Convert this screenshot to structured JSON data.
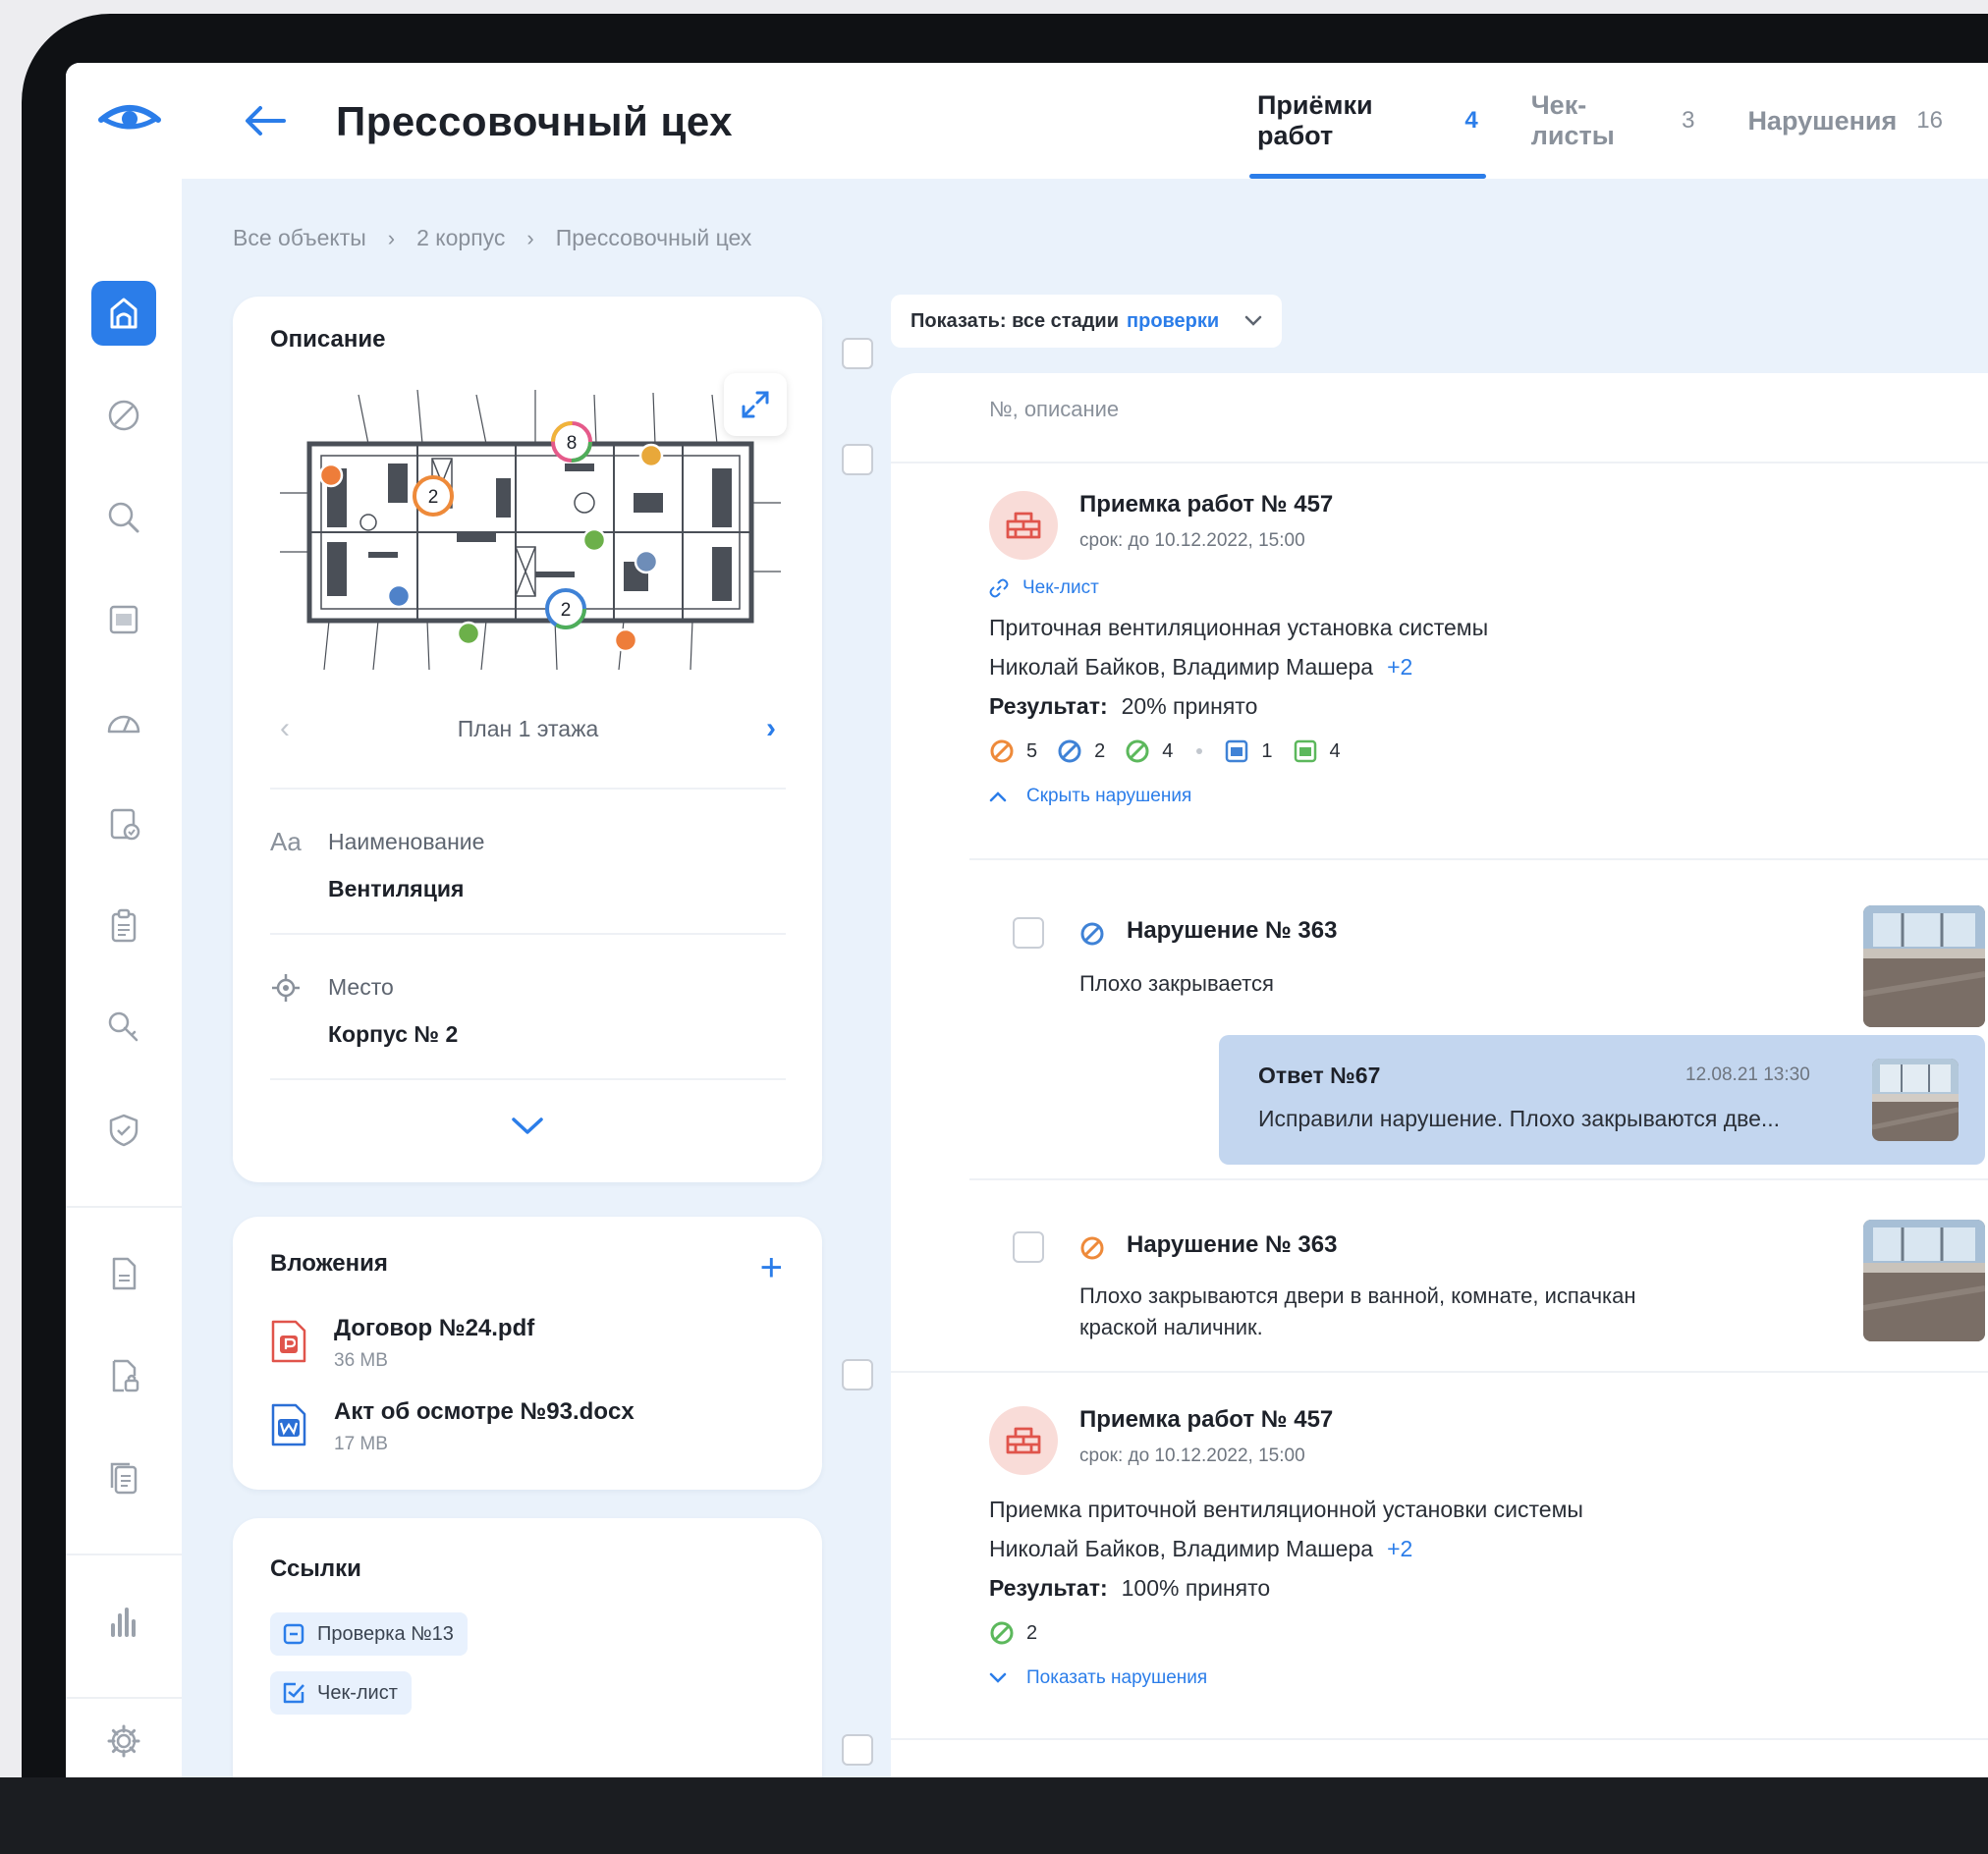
{
  "header": {
    "title": "Прессовочный цех",
    "tabs": [
      {
        "label": "Приёмки работ",
        "count": "4",
        "active": true
      },
      {
        "label": "Чек-листы",
        "count": "3",
        "active": false
      },
      {
        "label": "Нарушения",
        "count": "16",
        "active": false
      }
    ]
  },
  "sidebar": {
    "items": [
      "objects-icon",
      "prohibited-icon",
      "search-icon",
      "calendar-icon",
      "gauge-icon",
      "checklist-icon",
      "clipboard-icon",
      "key-search-icon",
      "shield-icon",
      "document-icon",
      "document-lock-icon",
      "files-icon",
      "chart-icon",
      "gear-icon"
    ]
  },
  "breadcrumb": [
    "Все объекты",
    "2 корпус",
    "Прессовочный цех"
  ],
  "description": {
    "title": "Описание",
    "plan_label": "План 1 этажа",
    "marker_labels": [
      "2",
      "8",
      "2"
    ],
    "name_label": "Наименование",
    "name_value": "Вентиляция",
    "place_label": "Место",
    "place_value": "Корпус № 2"
  },
  "attachments": {
    "title": "Вложения",
    "files": [
      {
        "name": "Договор №24.pdf",
        "size": "36 MB"
      },
      {
        "name": "Акт об осмотре №93.docx",
        "size": "17 MB"
      }
    ]
  },
  "links": {
    "title": "Ссылки",
    "items": [
      "Проверка №13",
      "Чек-лист"
    ]
  },
  "filter": {
    "prefix": "Показать: все стадии",
    "accent": "проверки"
  },
  "list": {
    "header": "№, описание",
    "acceptances": [
      {
        "title": "Приемка работ № 457",
        "deadline": "срок: до 10.12.2022, 15:00",
        "link": "Чек-лист",
        "description": "Приточная вентиляционная установка системы",
        "people": "Николай Байков, Владимир Машера",
        "people_extra": "+2",
        "result_label": "Результат:",
        "result_value": "20% принято",
        "stats": [
          "5",
          "2",
          "4",
          "1",
          "4"
        ],
        "toggle": "Скрыть нарушения"
      },
      {
        "title": "Приемка работ № 457",
        "deadline": "срок: до 10.12.2022, 15:00",
        "description": "Приемка приточной вентиляционной установки системы",
        "people": "Николай Байков, Владимир Машера",
        "people_extra": "+2",
        "result_label": "Результат:",
        "result_value": "100% принято",
        "stats": [
          "2"
        ],
        "toggle": "Показать нарушения"
      }
    ],
    "violations": [
      {
        "title": "Нарушение № 363",
        "text": "Плохо закрывается"
      },
      {
        "title": "Нарушение № 363",
        "text_line1": "Плохо закрываются двери в ванной, комнате, испачкан",
        "text_line2": "краской наличник."
      }
    ],
    "answer": {
      "title": "Ответ №67",
      "date": "12.08.21 13:30",
      "text": "Исправили нарушение. Плохо закрываются две..."
    }
  },
  "colors": {
    "accent": "#2b7de9",
    "orange": "#ee8a3a",
    "green": "#5cb85c",
    "blue": "#3f82d6",
    "avatar_bg": "#f9dcd8",
    "answer_bg": "#c3d6ef"
  }
}
